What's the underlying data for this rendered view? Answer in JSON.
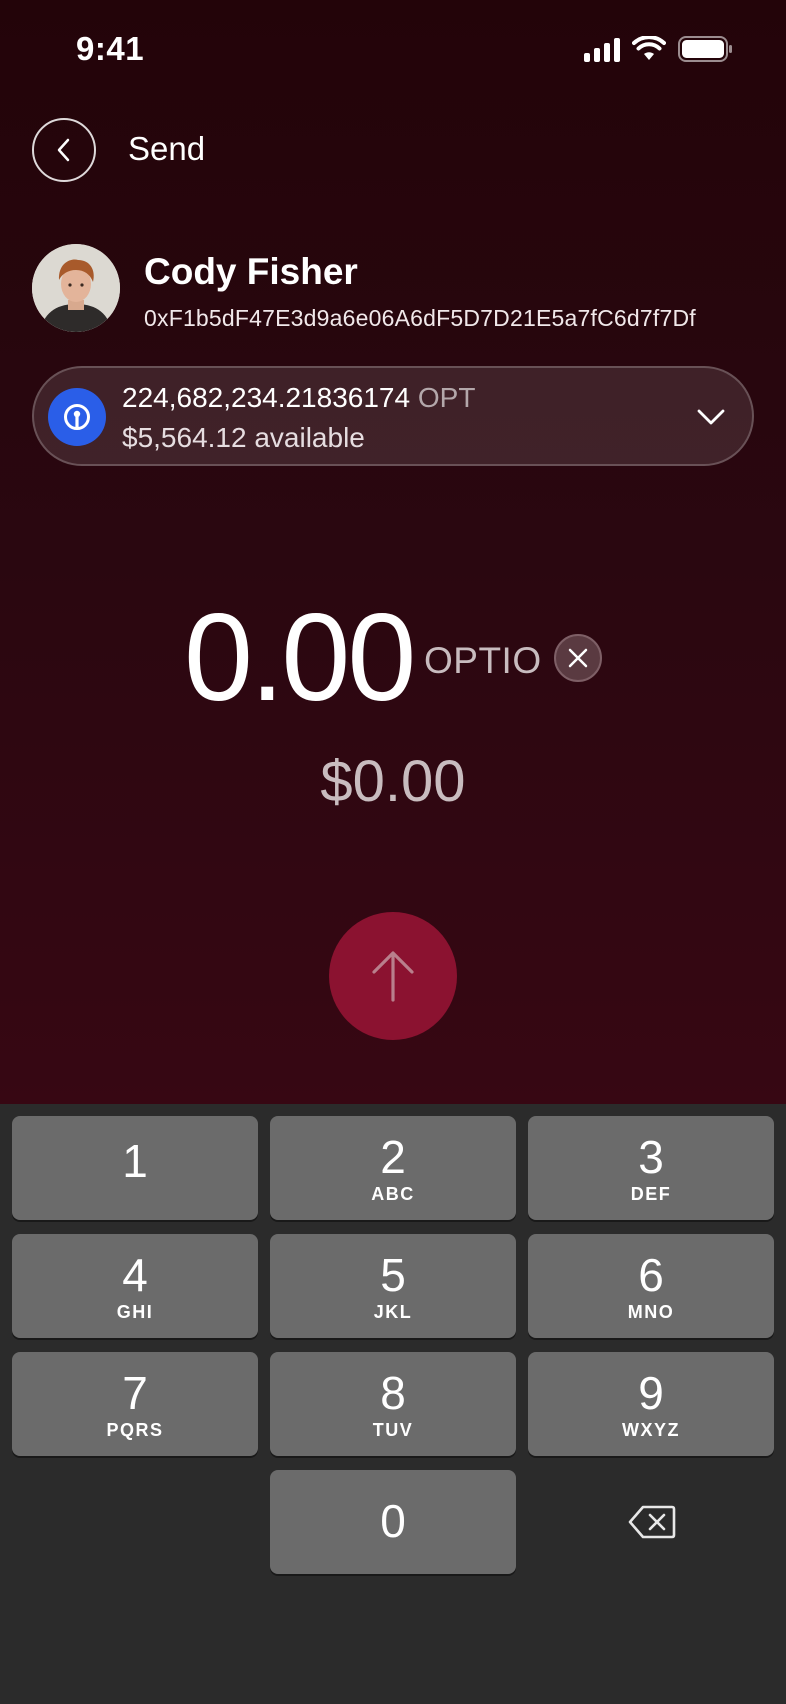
{
  "status_bar": {
    "time": "9:41"
  },
  "header": {
    "title": "Send"
  },
  "recipient": {
    "name": "Cody Fisher",
    "address": "0xF1b5dF47E3d9a6e06A6dF5D7D21E5a7fC6d7f7Df"
  },
  "token": {
    "balance": "224,682,234.21836174",
    "symbol": "OPT",
    "available": "$5,564.12 available"
  },
  "amount": {
    "value": "0.00",
    "unit": "OPTIO",
    "fiat": "$0.00"
  },
  "keypad": {
    "keys": [
      {
        "num": "1",
        "letters": ""
      },
      {
        "num": "2",
        "letters": "ABC"
      },
      {
        "num": "3",
        "letters": "DEF"
      },
      {
        "num": "4",
        "letters": "GHI"
      },
      {
        "num": "5",
        "letters": "JKL"
      },
      {
        "num": "6",
        "letters": "MNO"
      },
      {
        "num": "7",
        "letters": "PQRS"
      },
      {
        "num": "8",
        "letters": "TUV"
      },
      {
        "num": "9",
        "letters": "WXYZ"
      },
      {
        "num": "0",
        "letters": ""
      }
    ]
  },
  "colors": {
    "background_top": "#230409",
    "background_bottom": "#370713",
    "send_button": "#8b1230",
    "token_icon": "#2a5ee8",
    "keypad_bg": "#2b2b2b",
    "key_bg": "#6b6b6b"
  },
  "icons": {
    "back": "chevron-left-icon",
    "token": "optio-token-icon",
    "dropdown": "chevron-down-icon",
    "clear": "close-icon",
    "send": "arrow-up-icon",
    "backspace": "backspace-icon"
  }
}
